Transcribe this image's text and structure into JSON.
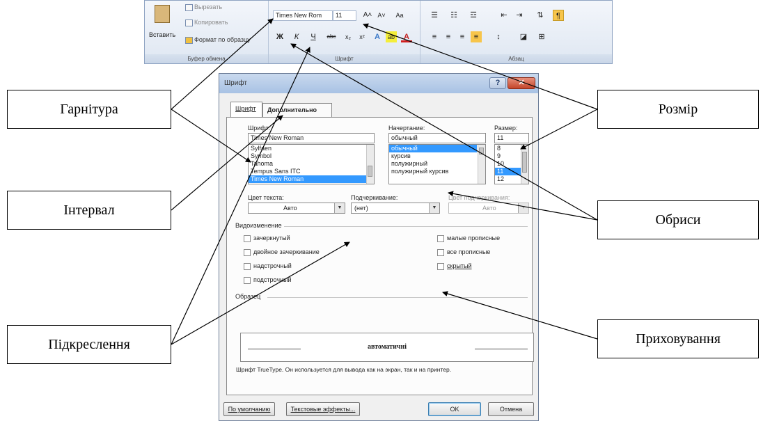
{
  "ribbon": {
    "clipboard": {
      "paste_label": "Вставить",
      "cut_label": "Вырезать",
      "copy_label": "Копировать",
      "format_painter_label": "Формат по образцу",
      "group_label": "Буфер обмена"
    },
    "font": {
      "font_name": "Times New Rom",
      "font_size": "11",
      "grow_label": "A˄",
      "shrink_label": "A˅",
      "case_label": "Aa",
      "bold_label": "Ж",
      "italic_label": "К",
      "underline_label": "Ч",
      "strike_label": "abc",
      "subscript_label": "x₂",
      "superscript_label": "x²",
      "group_label": "Шрифт"
    },
    "paragraph": {
      "group_label": "Абзац"
    }
  },
  "dialog": {
    "title": "Шрифт",
    "tabs": [
      "Шрифт",
      "Дополнительно"
    ],
    "font_label": "Шрифт:",
    "font_value": "Times New Roman",
    "font_list": [
      "Sylfaen",
      "Symbol",
      "Tahoma",
      "Tempus Sans ITC",
      "Times New Roman"
    ],
    "style_label": "Начертание:",
    "style_value": "обычный",
    "style_list": [
      "обычный",
      "курсив",
      "полужирный",
      "полужирный курсив"
    ],
    "size_label": "Размер:",
    "size_value": "11",
    "size_list": [
      "8",
      "9",
      "10",
      "11",
      "12"
    ],
    "text_color_label": "Цвет текста:",
    "text_color_value": "Авто",
    "underline_label": "Подчеркивание:",
    "underline_value": "(нет)",
    "underline_color_label": "Цвет подчеркивания:",
    "underline_color_value": "Авто",
    "effects_label": "Видоизменение",
    "effects_left": [
      "зачеркнутый",
      "двойное зачеркивание",
      "надстрочный",
      "подстрочный"
    ],
    "effects_right": [
      "малые прописные",
      "все прописные",
      "скрытый"
    ],
    "preview_label": "Образец",
    "preview_text": "автоматичні",
    "note": "Шрифт TrueType. Он используется для вывода как на экран, так и на принтер.",
    "buttons": {
      "default": "По умолчанию",
      "text_effects": "Текстовые эффекты...",
      "ok": "OK",
      "cancel": "Отмена"
    }
  },
  "callouts": {
    "typeface": "Гарнітура",
    "spacing": "Інтервал",
    "underline": "Підкреслення",
    "size": "Розмір",
    "outlines": "Обриси",
    "hiding": "Приховування"
  }
}
